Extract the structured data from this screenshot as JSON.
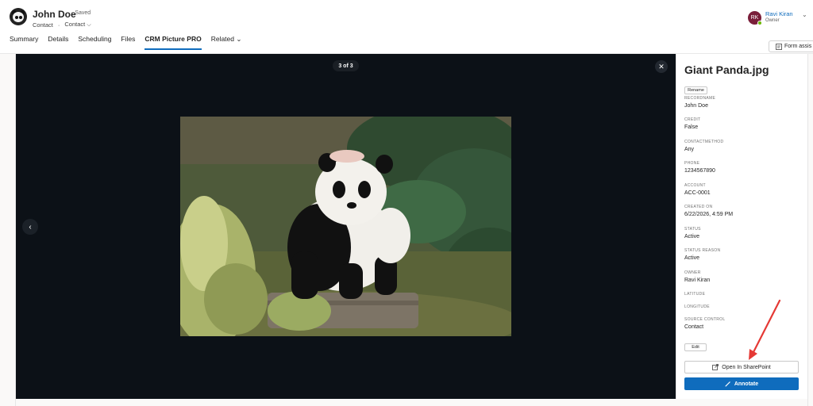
{
  "record": {
    "name": "John Doe",
    "saved_status": "- Saved",
    "entity": "Contact",
    "separator": "·",
    "form": "Contact",
    "form_chevron": "⌵"
  },
  "tabs": [
    {
      "label": "Summary"
    },
    {
      "label": "Details"
    },
    {
      "label": "Scheduling"
    },
    {
      "label": "Files"
    },
    {
      "label": "CRM Picture PRO"
    },
    {
      "label": "Related"
    }
  ],
  "tabs_related_chevron": "⌄",
  "owner": {
    "initials": "RK",
    "name": "Ravi Kiran",
    "role": "Owner",
    "chevron": "⌄"
  },
  "form_assist": {
    "label": "Form assis"
  },
  "viewer": {
    "counter": "3 of 3",
    "close_glyph": "✕",
    "prev_glyph": "‹"
  },
  "panel": {
    "file_title": "Giant Panda.jpg",
    "rename_label": "Rename",
    "fields": [
      {
        "label": "RECORDNAME",
        "value": "John Doe"
      },
      {
        "label": "CREDIT",
        "value": "False"
      },
      {
        "label": "CONTACTMETHOD",
        "value": "Any"
      },
      {
        "label": "PHONE",
        "value": "1234567890"
      },
      {
        "label": "ACCOUNT",
        "value": "ACC-0001"
      },
      {
        "label": "CREATED ON",
        "value": "6/22/2026, 4:59 PM"
      },
      {
        "label": "STATUS",
        "value": "Active"
      },
      {
        "label": "STATUS REASON",
        "value": "Active"
      },
      {
        "label": "OWNER",
        "value": "Ravi Kiran"
      },
      {
        "label": "LATITUDE",
        "value": ""
      },
      {
        "label": "LONGITUDE",
        "value": ""
      },
      {
        "label": "SOURCE CONTROL",
        "value": "Contact"
      }
    ],
    "edit_label": "Edit",
    "open_sharepoint_label": "Open In SharePoint",
    "annotate_label": "Annotate"
  },
  "colors": {
    "brand_blue": "#0f6cbd",
    "viewer_bg": "#0c1117",
    "annotation_arrow": "#e53935",
    "owner_avatar": "#7a1e3a"
  }
}
